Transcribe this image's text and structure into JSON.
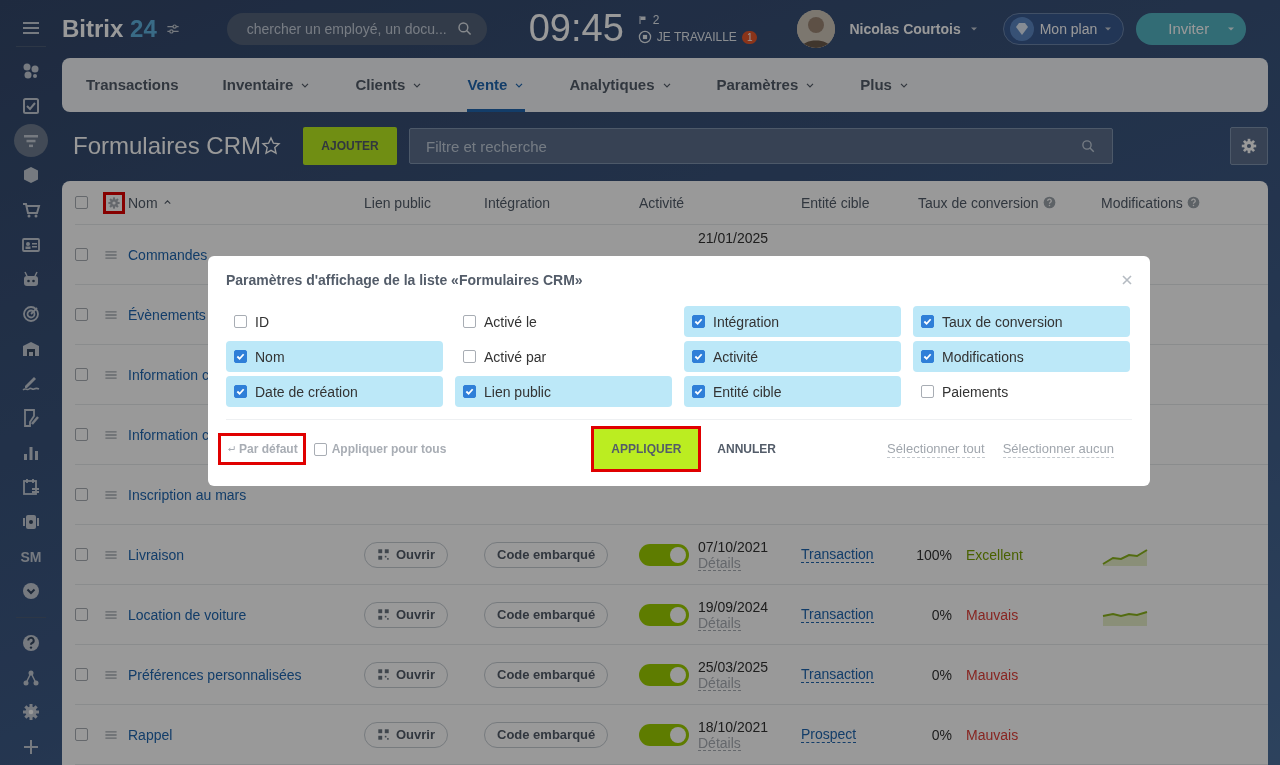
{
  "sidebar": {
    "items": [
      {
        "kind": "clover",
        "selected": false
      },
      {
        "kind": "task",
        "selected": false
      },
      {
        "kind": "filter",
        "selected": true
      },
      {
        "kind": "cube",
        "selected": false
      },
      {
        "kind": "cart",
        "selected": false
      },
      {
        "kind": "contact",
        "selected": false
      },
      {
        "kind": "robot",
        "selected": false
      },
      {
        "kind": "target",
        "selected": false
      },
      {
        "kind": "warehouse",
        "selected": false
      },
      {
        "kind": "signature",
        "selected": false
      },
      {
        "kind": "document",
        "selected": false
      },
      {
        "kind": "chart",
        "selected": false
      },
      {
        "kind": "calendar",
        "selected": false
      },
      {
        "kind": "video",
        "selected": false
      },
      {
        "kind": "text",
        "label": "SM",
        "selected": false
      },
      {
        "kind": "more",
        "selected": false
      }
    ],
    "bottom": [
      {
        "kind": "help"
      },
      {
        "kind": "network"
      },
      {
        "kind": "gear"
      },
      {
        "kind": "plus"
      }
    ]
  },
  "header": {
    "logo": "Bitrix",
    "logo_number": "24",
    "search": {
      "placeholder": "chercher un employé, un docu..."
    },
    "time": "09:45",
    "flags": "2",
    "work_status": "JE TRAVAILLE",
    "work_badge": "1",
    "user": "Nicolas Courtois",
    "plan": "Mon plan",
    "invite": "Inviter"
  },
  "tabs": [
    {
      "label": "Transactions",
      "dropdown": false,
      "selected": false
    },
    {
      "label": "Inventaire",
      "dropdown": true,
      "selected": false
    },
    {
      "label": "Clients",
      "dropdown": true,
      "selected": false
    },
    {
      "label": "Vente",
      "dropdown": true,
      "selected": true
    },
    {
      "label": "Analytiques",
      "dropdown": true,
      "selected": false
    },
    {
      "label": "Paramètres",
      "dropdown": true,
      "selected": false
    },
    {
      "label": "Plus",
      "dropdown": true,
      "selected": false
    }
  ],
  "page": {
    "title": "Formulaires CRM",
    "add_button": "AJOUTER",
    "filter": {
      "placeholder": "Filtre et recherche"
    }
  },
  "table": {
    "settings_highlighted": true,
    "select_all_checked": false,
    "columns": [
      {
        "label": "Nom",
        "sorted": true,
        "help": false
      },
      {
        "label": "Lien public",
        "sorted": false,
        "help": false
      },
      {
        "label": "Intégration",
        "sorted": false,
        "help": false
      },
      {
        "label": "Activité",
        "sorted": false,
        "help": false
      },
      {
        "label": "Entité cible",
        "sorted": false,
        "help": false
      },
      {
        "label": "Taux de conversion",
        "sorted": false,
        "help": true
      },
      {
        "label": "Modifications",
        "sorted": false,
        "help": true
      }
    ],
    "rows": [
      {
        "kind": "covered",
        "checked": false,
        "name": "Commandes",
        "date": "21/01/2025"
      },
      {
        "kind": "covered",
        "checked": false,
        "name": "Évènements"
      },
      {
        "kind": "covered",
        "checked": false,
        "name": "Information c"
      },
      {
        "kind": "covered",
        "checked": false,
        "name": "Information c"
      },
      {
        "kind": "covered",
        "checked": false,
        "name": "Inscription au mars"
      },
      {
        "kind": "full",
        "checked": false,
        "name": "Livraison",
        "link": "Ouvrir",
        "integration": "Code embarqué",
        "on": true,
        "date": "07/10/2021",
        "details": "Détails",
        "entity": "Transaction",
        "rate": "100%",
        "rating": "Excellent",
        "positive": true,
        "sparkline": true
      },
      {
        "kind": "full",
        "checked": false,
        "name": "Location de voiture",
        "link": "Ouvrir",
        "integration": "Code embarqué",
        "on": true,
        "date": "19/09/2024",
        "details": "Détails",
        "entity": "Transaction",
        "rate": "0%",
        "rating": "Mauvais",
        "positive": false,
        "sparkline": true
      },
      {
        "kind": "full",
        "checked": false,
        "name": "Préférences personnalisées",
        "link": "Ouvrir",
        "integration": "Code embarqué",
        "on": true,
        "date": "25/03/2025",
        "details": "Détails",
        "entity": "Transaction",
        "rate": "0%",
        "rating": "Mauvais",
        "positive": false,
        "sparkline": false
      },
      {
        "kind": "full",
        "checked": false,
        "name": "Rappel",
        "link": "Ouvrir",
        "integration": "Code embarqué",
        "on": true,
        "date": "18/10/2021",
        "details": "Détails",
        "entity": "Prospect",
        "rate": "0%",
        "rating": "Mauvais",
        "positive": false,
        "sparkline": false
      }
    ]
  },
  "dialog": {
    "title": "Paramètres d'affichage de la liste «Formulaires CRM»",
    "options": [
      {
        "label": "ID",
        "checked": false
      },
      {
        "label": "Activé le",
        "checked": false
      },
      {
        "label": "Intégration",
        "checked": true
      },
      {
        "label": "Taux de conversion",
        "checked": true
      },
      {
        "label": "Nom",
        "checked": true
      },
      {
        "label": "Activé par",
        "checked": false
      },
      {
        "label": "Activité",
        "checked": true
      },
      {
        "label": "Modifications",
        "checked": true
      },
      {
        "label": "Date de création",
        "checked": true
      },
      {
        "label": "Lien public",
        "checked": true
      },
      {
        "label": "Entité cible",
        "checked": true
      },
      {
        "label": "Paiements",
        "checked": false
      }
    ],
    "default_button": {
      "label": "Par défaut",
      "highlighted": true
    },
    "apply_all": {
      "label": "Appliquer pour tous",
      "checked": false
    },
    "apply_button": {
      "label": "APPLIQUER",
      "highlighted": true
    },
    "cancel_button": "ANNULER",
    "select_all": "Sélectionner tout",
    "select_none": "Sélectionner aucun"
  }
}
